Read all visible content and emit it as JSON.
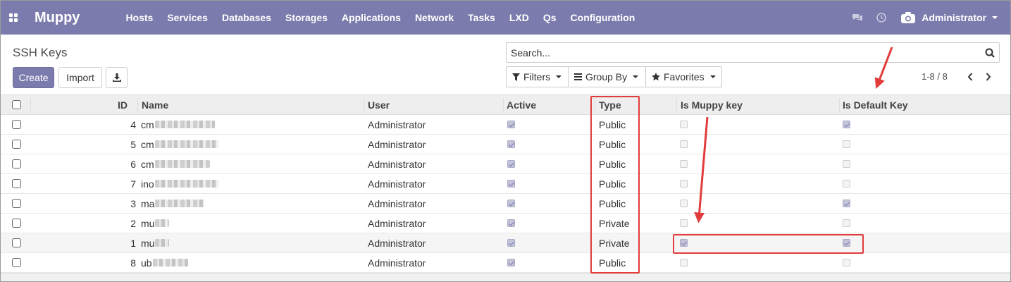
{
  "app": {
    "brand": "Muppy"
  },
  "nav": {
    "menu": [
      "Hosts",
      "Services",
      "Databases",
      "Storages",
      "Applications",
      "Network",
      "Tasks",
      "LXD",
      "Qs",
      "Configuration"
    ],
    "user": "Administrator"
  },
  "control_panel": {
    "title": "SSH Keys",
    "create_label": "Create",
    "import_label": "Import",
    "search_placeholder": "Search...",
    "filters_label": "Filters",
    "groupby_label": "Group By",
    "favorites_label": "Favorites",
    "pager": "1-8 / 8"
  },
  "table": {
    "columns": {
      "id": "ID",
      "name": "Name",
      "user": "User",
      "active": "Active",
      "type": "Type",
      "is_muppy": "Is Muppy key",
      "is_default": "Is Default Key"
    },
    "rows": [
      {
        "id": "4",
        "name": "cm",
        "user": "Administrator",
        "active": true,
        "type": "Public",
        "is_muppy": false,
        "is_default": true
      },
      {
        "id": "5",
        "name": "cm",
        "user": "Administrator",
        "active": true,
        "type": "Public",
        "is_muppy": false,
        "is_default": false
      },
      {
        "id": "6",
        "name": "cm",
        "user": "Administrator",
        "active": true,
        "type": "Public",
        "is_muppy": false,
        "is_default": false
      },
      {
        "id": "7",
        "name": "ino",
        "user": "Administrator",
        "active": true,
        "type": "Public",
        "is_muppy": false,
        "is_default": false
      },
      {
        "id": "3",
        "name": "ma",
        "user": "Administrator",
        "active": true,
        "type": "Public",
        "is_muppy": false,
        "is_default": true
      },
      {
        "id": "2",
        "name": "mu",
        "user": "Administrator",
        "active": true,
        "type": "Private",
        "is_muppy": false,
        "is_default": false
      },
      {
        "id": "1",
        "name": "mu",
        "user": "Administrator",
        "active": true,
        "type": "Private",
        "is_muppy": true,
        "is_default": true
      },
      {
        "id": "8",
        "name": "ub",
        "user": "Administrator",
        "active": true,
        "type": "Public",
        "is_muppy": false,
        "is_default": false
      }
    ]
  },
  "colors": {
    "brand": "#7c7bad",
    "annotation": "#e23b3b"
  }
}
